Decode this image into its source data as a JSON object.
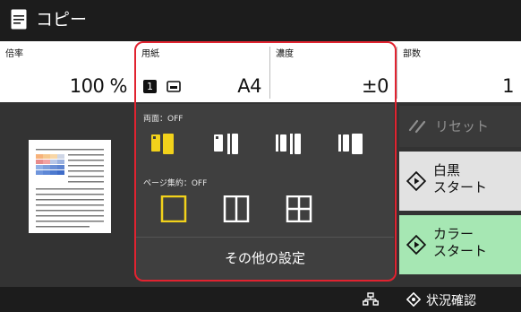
{
  "header": {
    "title": "コピー",
    "icon": "copy-app-icon"
  },
  "settings": {
    "ratio": {
      "label": "倍率",
      "value": "100 %"
    },
    "paper": {
      "label": "用紙",
      "drawer": "1",
      "value": "A4",
      "tray_icon": "paper-tray-icon"
    },
    "density": {
      "label": "濃度",
      "value": "±0"
    },
    "copies": {
      "label": "部数",
      "value": "1"
    }
  },
  "quick_panel": {
    "duplex_label": "両面：OFF",
    "duplex_options": [
      "1-sided to 1-sided",
      "1-sided to 2-sided",
      "2-sided to 2-sided",
      "2-sided to 1-sided"
    ],
    "nup_label": "ページ集約：OFF",
    "nup_options": [
      "off",
      "2 on 1",
      "4 on 1"
    ],
    "other_settings": "その他の設定"
  },
  "actions": {
    "reset": "リセット",
    "bw_start_line1": "白黒",
    "bw_start_line2": "スタート",
    "color_start_line1": "カラー",
    "color_start_line2": "スタート"
  },
  "status": {
    "label": "状況確認",
    "network_icon": "network-icon"
  },
  "colors": {
    "accent_yellow": "#f2d21b",
    "highlight_red": "#e12330",
    "color_start_green": "#a6e7b3",
    "bw_start_gray": "#e2e2e2"
  }
}
